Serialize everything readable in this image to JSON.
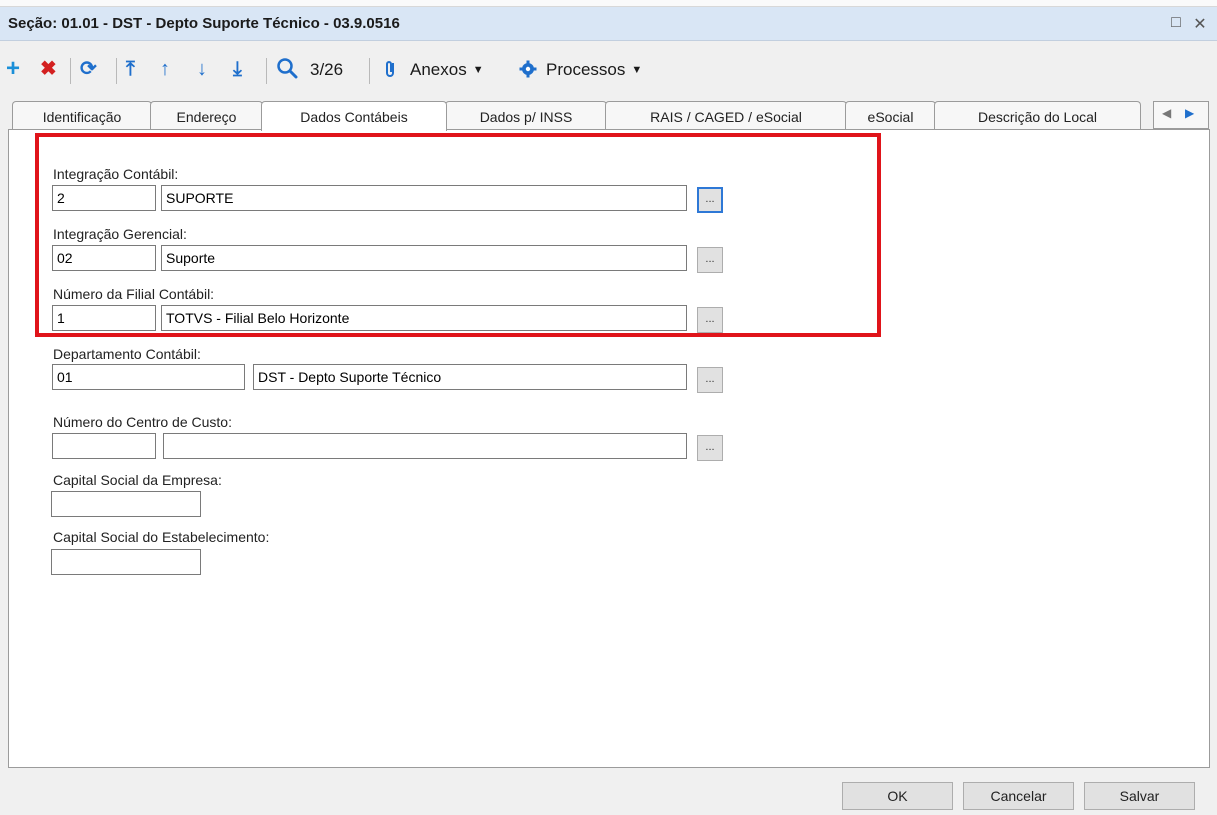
{
  "window": {
    "title": "Seção: 01.01 - DST - Depto Suporte Técnico - 03.9.0516",
    "restore_glyph": "□",
    "close_glyph": "✕"
  },
  "toolbar": {
    "record_counter": "3/26",
    "attachments_label": "Anexos",
    "processes_label": "Processos",
    "icons": [
      "add-icon",
      "delete-icon",
      "refresh-icon",
      "first-record-icon",
      "previous-record-icon",
      "next-record-icon",
      "last-record-icon",
      "search-icon",
      "paperclip-icon",
      "gear-icon"
    ],
    "colors": {
      "add": "#1a8fd8",
      "delete": "#d32020",
      "nav": "#1f6fcc"
    }
  },
  "tabs": [
    {
      "label": "Identificação"
    },
    {
      "label": "Endereço"
    },
    {
      "label": "Dados Contábeis",
      "active": true
    },
    {
      "label": "Dados p/ INSS"
    },
    {
      "label": "RAIS / CAGED / eSocial"
    },
    {
      "label": "eSocial"
    },
    {
      "label": "Descrição do Local"
    }
  ],
  "form": {
    "integracao_contabil": {
      "label": "Integração Contábil:",
      "code": "2",
      "description": "SUPORTE"
    },
    "integracao_gerencial": {
      "label": "Integração Gerencial:",
      "code": "02",
      "description": "Suporte"
    },
    "filial_contabil": {
      "label": "Número da Filial Contábil:",
      "code": "1",
      "description": "TOTVS - Filial Belo Horizonte"
    },
    "departamento_contabil": {
      "label": "Departamento Contábil:",
      "code": "01",
      "description": "DST - Depto Suporte Técnico"
    },
    "centro_custo": {
      "label": "Número do Centro de Custo:",
      "code": "",
      "description": ""
    },
    "capital_empresa": {
      "label": "Capital Social da Empresa:",
      "value": ""
    },
    "capital_estabelecimento": {
      "label": "Capital Social do Estabelecimento:",
      "value": ""
    },
    "lookup_label": "..."
  },
  "highlight_color": "#e0141a",
  "footer": {
    "ok": "OK",
    "cancel": "Cancelar",
    "save": "Salvar"
  }
}
